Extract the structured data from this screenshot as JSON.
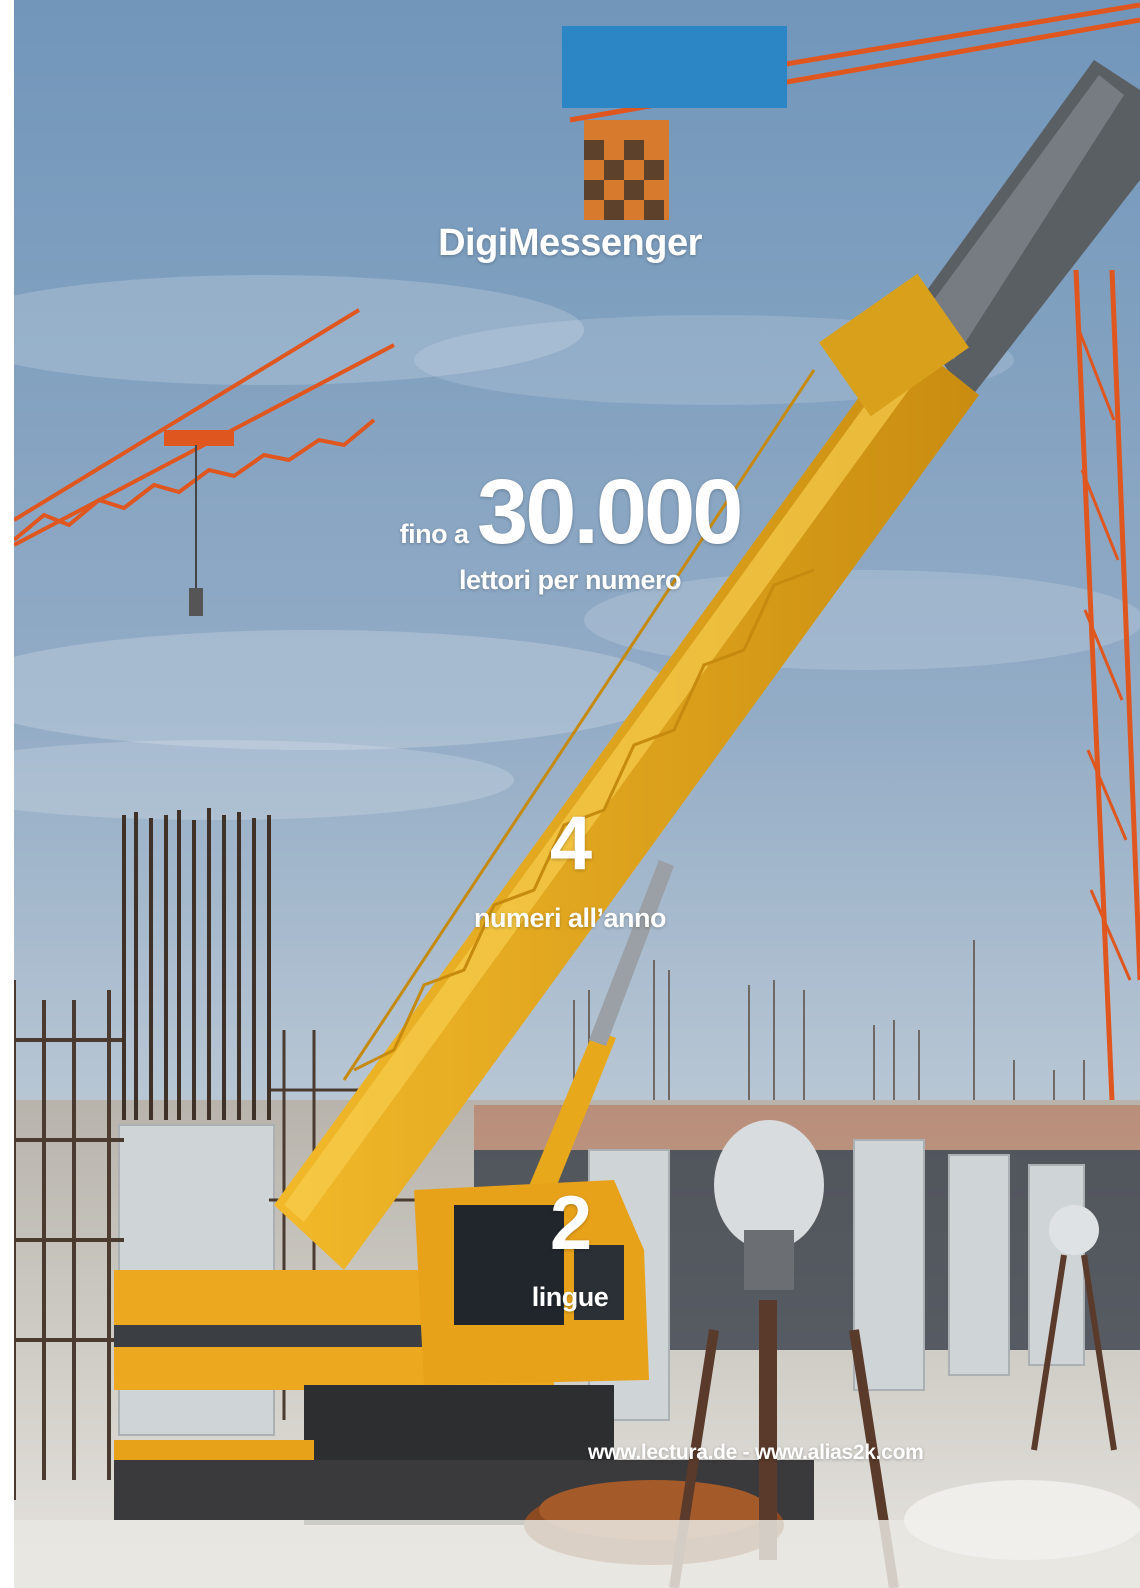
{
  "brand": {
    "name": "DigiMessenger"
  },
  "stats": [
    {
      "prefix": "fino a",
      "value": "30.000",
      "label": "lettori per numero"
    },
    {
      "value": "4",
      "label": "numeri all’anno"
    },
    {
      "value": "2",
      "label": "lingue"
    }
  ],
  "footer": {
    "links": "www.lectura.de - www.alias2k.com"
  },
  "photo": {
    "subject": "construction-site-with-yellow-mobile-crane-and-tower-cranes"
  },
  "colors": {
    "sky_top": "#6f93b8",
    "sky_bottom": "#c9d4dd",
    "crane_yellow": "#e8a81c",
    "tower_crane_orange": "#e0561f",
    "text": "#ffffff"
  }
}
